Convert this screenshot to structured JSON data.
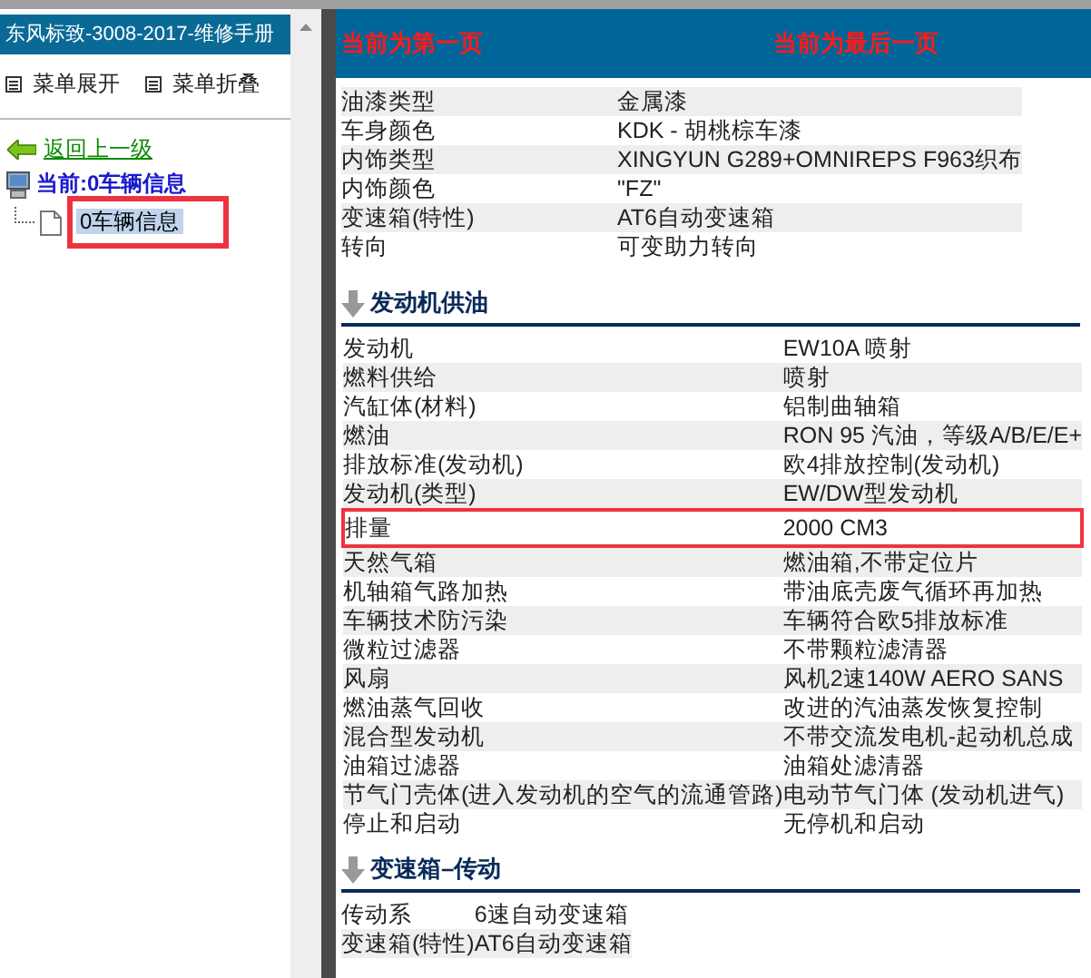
{
  "sidebar": {
    "title": "东风标致-3008-2017-维修手册",
    "menu": [
      {
        "label": "菜单展开"
      },
      {
        "label": "菜单折叠"
      }
    ],
    "back_link": "返回上一级",
    "tree": {
      "label": "当前:0车辆信息",
      "children": [
        {
          "label": "0车辆信息",
          "selected": true,
          "highlighted": true
        }
      ]
    }
  },
  "content": {
    "pager": {
      "first": "当前为第一页",
      "last": "当前为最后一页"
    },
    "sections": [
      {
        "rows": [
          {
            "label": "油漆类型",
            "value": "金属漆",
            "highlighted": false
          },
          {
            "label": "车身颜色",
            "value": "KDK - 胡桃棕车漆",
            "highlighted": false
          },
          {
            "label": "内饰类型",
            "value": "XINGYUN G289+OMNIREPS F963织布",
            "highlighted": false
          },
          {
            "label": "内饰颜色",
            "value": "\"FZ\"",
            "highlighted": false
          },
          {
            "label": "变速箱(特性)",
            "value": "AT6自动变速箱",
            "highlighted": false
          },
          {
            "label": "转向",
            "value": "可变助力转向",
            "highlighted": false
          }
        ]
      },
      {
        "title": "发动机供油",
        "rows": [
          {
            "label": "发动机",
            "value": "EW10A 喷射",
            "highlighted": false
          },
          {
            "label": "燃料供给",
            "value": "喷射",
            "highlighted": false
          },
          {
            "label": "汽缸体(材料)",
            "value": "铝制曲轴箱",
            "highlighted": false
          },
          {
            "label": "燃油",
            "value": "RON 95 汽油，等级A/B/E/E+",
            "highlighted": false
          },
          {
            "label": "排放标准(发动机)",
            "value": "欧4排放控制(发动机)",
            "highlighted": false
          },
          {
            "label": "发动机(类型)",
            "value": "EW/DW型发动机",
            "highlighted": false
          },
          {
            "label": "排量",
            "value": "2000 CM3",
            "highlighted": true
          },
          {
            "label": "天然气箱",
            "value": "燃油箱,不带定位片",
            "highlighted": false
          },
          {
            "label": "机轴箱气路加热",
            "value": "带油底壳废气循环再加热",
            "highlighted": false
          },
          {
            "label": "车辆技术防污染",
            "value": "车辆符合欧5排放标准",
            "highlighted": false
          },
          {
            "label": "微粒过滤器",
            "value": "不带颗粒滤清器",
            "highlighted": false
          },
          {
            "label": "风扇",
            "value": "风机2速140W AERO SANS",
            "highlighted": false
          },
          {
            "label": "燃油蒸气回收",
            "value": "改进的汽油蒸发恢复控制",
            "highlighted": false
          },
          {
            "label": "混合型发动机",
            "value": "不带交流发电机-起动机总成",
            "highlighted": false
          },
          {
            "label": "油箱过滤器",
            "value": "油箱处滤清器",
            "highlighted": false
          },
          {
            "label": "节气门壳体(进入发动机的空气的流通管路)",
            "value": "电动节气门体 (发动机进气)",
            "highlighted": false
          },
          {
            "label": "停止和启动",
            "value": "无停机和启动",
            "highlighted": false
          }
        ]
      },
      {
        "title": "变速箱–传动",
        "rows": [
          {
            "label": "传动系",
            "value": "6速自动变速箱",
            "highlighted": false
          },
          {
            "label": "变速箱(特性)",
            "value": "AT6自动变速箱",
            "highlighted": false
          }
        ]
      }
    ]
  }
}
